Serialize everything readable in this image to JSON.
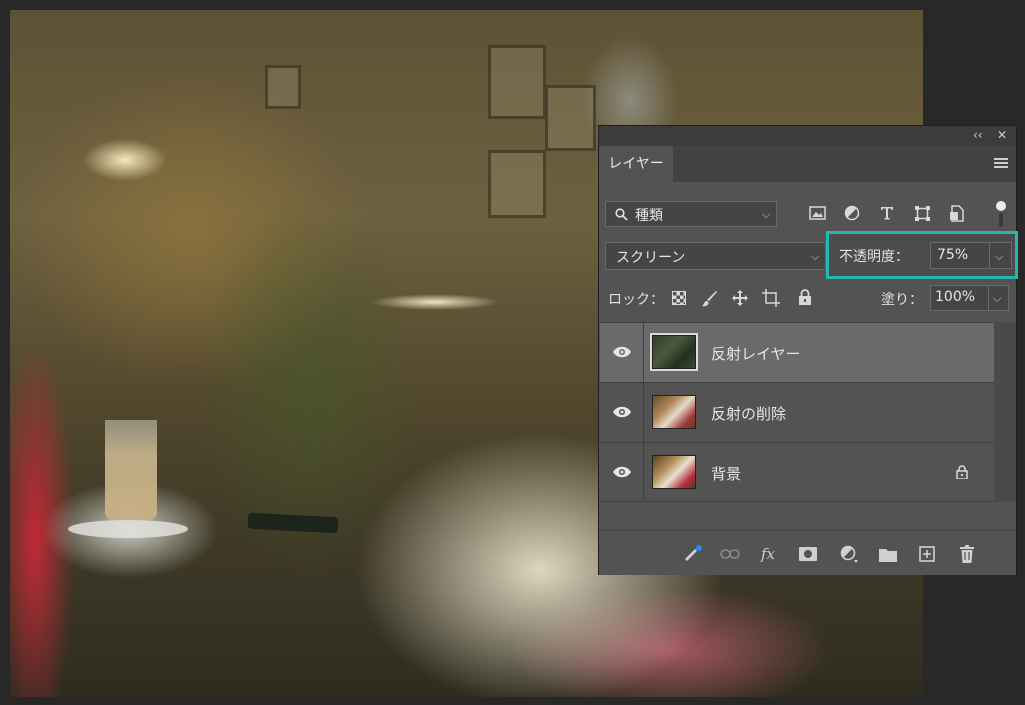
{
  "panel": {
    "collapse_label": "‹‹",
    "close_label": "✕",
    "tab_label": "レイヤー"
  },
  "filter": {
    "kind_label": "種類",
    "icons": [
      "image-filter-icon",
      "adjustment-filter-icon",
      "type-filter-icon",
      "shape-filter-icon",
      "smart-object-filter-icon"
    ]
  },
  "blend": {
    "mode": "スクリーン",
    "opacity_label": "不透明度：",
    "opacity_value": "75%",
    "highlight_color": "#25b6ae"
  },
  "lock": {
    "label": "ロック：",
    "fill_label": "塗り：",
    "fill_value": "100%"
  },
  "layers": [
    {
      "name": "反射レイヤー",
      "visible": true,
      "selected": true,
      "locked": false
    },
    {
      "name": "反射の削除",
      "visible": true,
      "selected": false,
      "locked": false
    },
    {
      "name": "背景",
      "visible": true,
      "selected": false,
      "locked": true
    }
  ],
  "bottom_tools": {
    "fx_label": "fx"
  }
}
